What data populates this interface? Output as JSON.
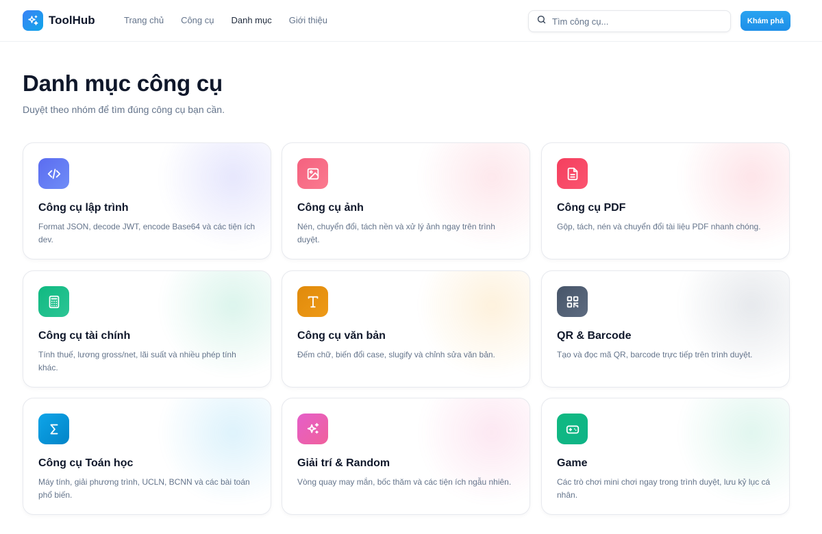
{
  "header": {
    "logo_text": "ToolHub",
    "nav": [
      "Trang chủ",
      "Công cụ",
      "Danh mục",
      "Giới thiệu"
    ],
    "active_nav": "Danh mục",
    "search_placeholder": "Tìm công cụ...",
    "cta_label": "Khám phá"
  },
  "page": {
    "title": "Danh mục công cụ",
    "subtitle": "Duyệt theo nhóm để tìm đúng công cụ bạn cần."
  },
  "categories": [
    {
      "title": "Công cụ lập trình",
      "desc": "Format JSON, decode JWT, encode Base64 và các tiện ích dev.",
      "icon": "code-icon",
      "color": "#5b6cf0"
    },
    {
      "title": "Công cụ ảnh",
      "desc": "Nén, chuyển đổi, tách nền và xử lý ảnh ngay trên trình duyệt.",
      "icon": "image-icon",
      "color": "#f4617f"
    },
    {
      "title": "Công cụ PDF",
      "desc": "Gộp, tách, nén và chuyển đổi tài liệu PDF nhanh chóng.",
      "icon": "document-icon",
      "color": "#f43f5e"
    },
    {
      "title": "Công cụ tài chính",
      "desc": "Tính thuế, lương gross/net, lãi suất và nhiều phép tính khác.",
      "icon": "calculator-icon",
      "color": "#10b981"
    },
    {
      "title": "Công cụ văn bản",
      "desc": "Đếm chữ, biến đổi case, slugify và chỉnh sửa văn bản.",
      "icon": "text-icon",
      "color": "#e08a0b"
    },
    {
      "title": "QR & Barcode",
      "desc": "Tạo và đọc mã QR, barcode trực tiếp trên trình duyệt.",
      "icon": "qr-code-icon",
      "color": "#475569"
    },
    {
      "title": "Công cụ Toán học",
      "desc": "Máy tính, giải phương trình, UCLN, BCNN và các bài toán phổ biến.",
      "icon": "sigma-icon",
      "color": "#0ea5e9"
    },
    {
      "title": "Giải trí & Random",
      "desc": "Vòng quay may mắn, bốc thăm và các tiện ích ngẫu nhiên.",
      "icon": "sparkles-icon",
      "color": "#e55fc9"
    },
    {
      "title": "Game",
      "desc": "Các trò chơi mini chơi ngay trong trình duyệt, lưu kỷ lục cá nhân.",
      "icon": "gamepad-icon",
      "color": "#10b981"
    }
  ]
}
